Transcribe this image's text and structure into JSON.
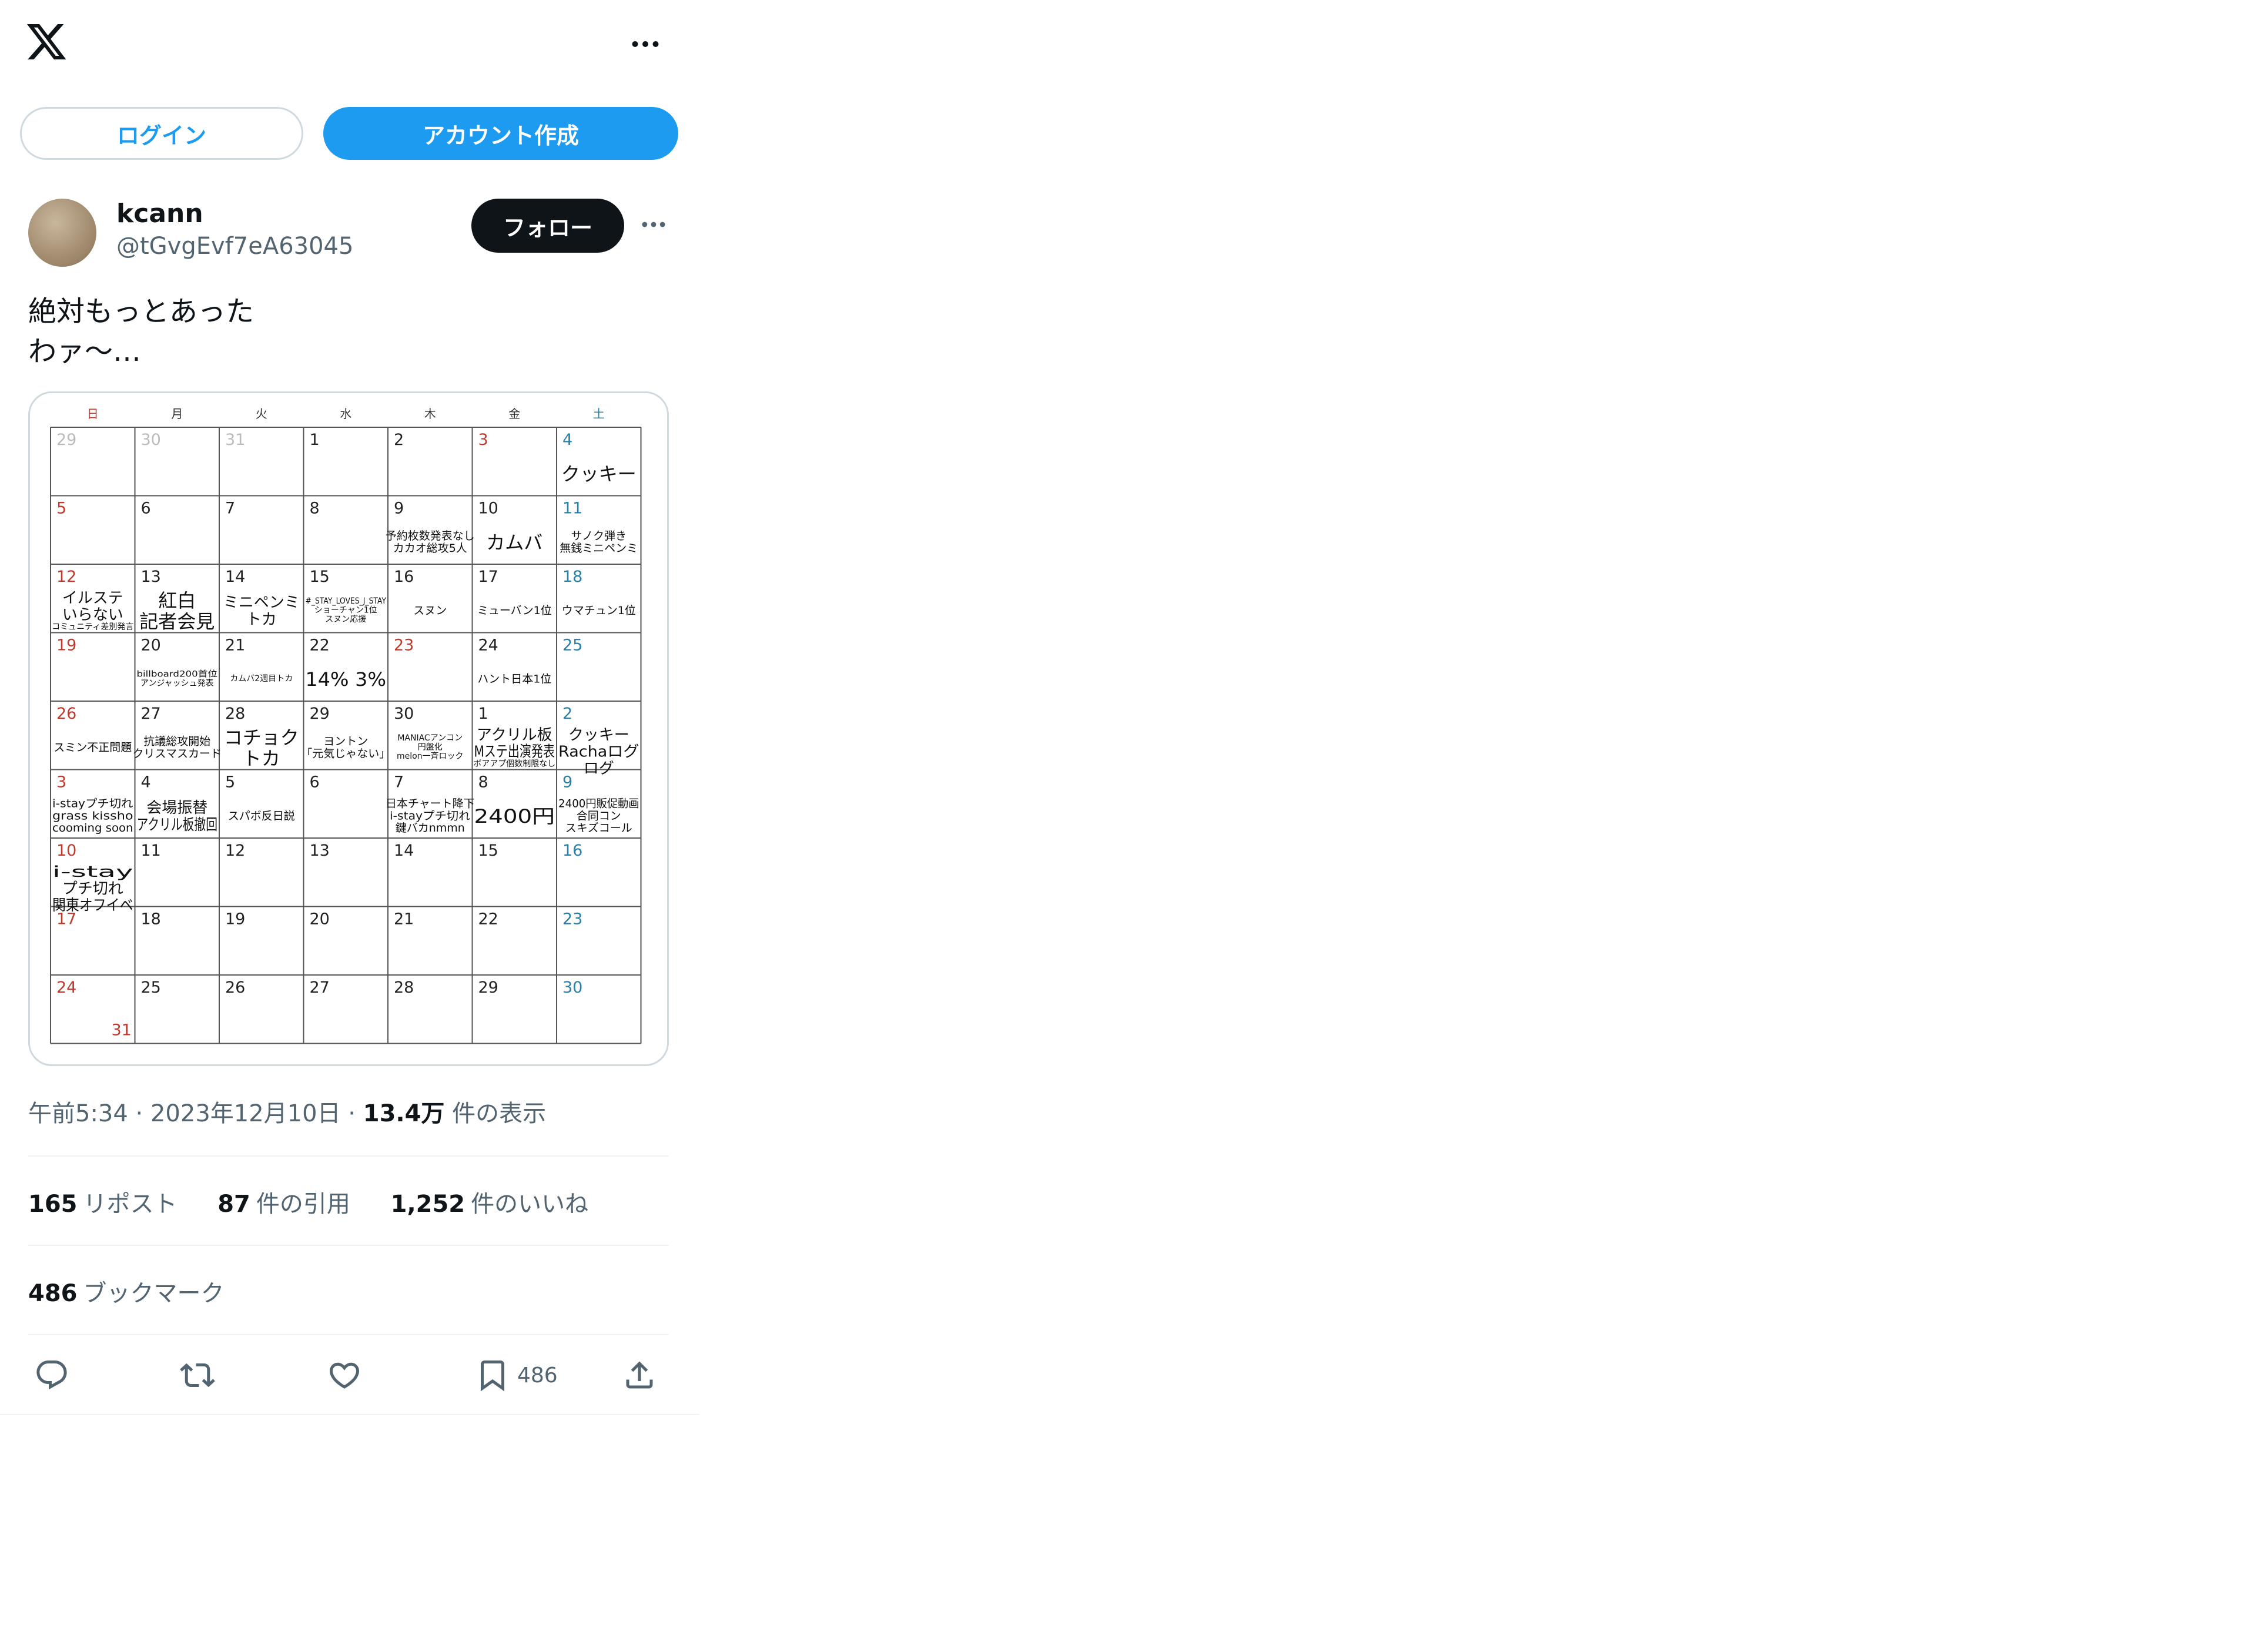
{
  "app": {
    "more_icon": "more-horizontal-icon",
    "logo_icon": "x-logo-icon"
  },
  "auth": {
    "login_label": "ログイン",
    "signup_label": "アカウント作成",
    "accent_color": "#1d9bf0"
  },
  "post": {
    "author_name": "kcann",
    "author_handle": "@tGvgEvf7eA63045",
    "follow_label": "フォロー",
    "text_lines": [
      "絶対もっとあった",
      "わァ〜…"
    ],
    "time": "午前5:34",
    "date": "2023年12月10日",
    "sep": "·",
    "views_count": "13.4万",
    "views_label": "件の表示",
    "reposts_count": "165",
    "reposts_label": "リポスト",
    "quotes_count": "87",
    "quotes_label": "件の引用",
    "likes_count": "1,252",
    "likes_label": "件のいいね",
    "bookmarks_count": "486",
    "bookmarks_label": "ブックマーク",
    "action_bookmark_count": "486"
  },
  "calendar": {
    "weekdays": [
      "日",
      "月",
      "火",
      "水",
      "木",
      "金",
      "土"
    ],
    "weekday_colors": [
      "#c0392b",
      "#333333",
      "#333333",
      "#333333",
      "#333333",
      "#333333",
      "#2a7fa8"
    ],
    "sunday_color": "#c0392b",
    "saturday_color": "#2a7fa8",
    "prev_month_color": "#bbbbbb",
    "cells": [
      {
        "d": "29",
        "faded": true,
        "notes": []
      },
      {
        "d": "30",
        "faded": true,
        "notes": []
      },
      {
        "d": "31",
        "faded": true,
        "notes": []
      },
      {
        "d": "1",
        "notes": []
      },
      {
        "d": "2",
        "notes": []
      },
      {
        "d": "3",
        "notes": [],
        "red": true
      },
      {
        "d": "4",
        "notes": [
          "クッキー"
        ],
        "size": "big"
      },
      {
        "d": "5",
        "notes": []
      },
      {
        "d": "6",
        "notes": []
      },
      {
        "d": "7",
        "notes": []
      },
      {
        "d": "8",
        "notes": []
      },
      {
        "d": "9",
        "notes": [
          "予約枚数発表なし",
          "カカオ総攻5人"
        ],
        "size": "small"
      },
      {
        "d": "10",
        "notes": [
          "カムバ"
        ],
        "size": "big"
      },
      {
        "d": "11",
        "notes": [
          "サノク弾き",
          "無銭ミニペンミ"
        ],
        "size": "small"
      },
      {
        "d": "12",
        "notes": [
          "イルステ",
          "いらない",
          "コミュニティ差別発言"
        ],
        "size": "mixed"
      },
      {
        "d": "13",
        "notes": [
          "紅白",
          "記者会見"
        ],
        "size": "big"
      },
      {
        "d": "14",
        "notes": [
          "ミニペンミ",
          "トカ"
        ],
        "size": "mid"
      },
      {
        "d": "15",
        "notes": [
          "#_STAY_LOVES_J_STAY",
          "ショーチャン1位",
          "スヌン応援"
        ],
        "size": "tiny"
      },
      {
        "d": "16",
        "notes": [
          "スヌン"
        ],
        "size": "small"
      },
      {
        "d": "17",
        "notes": [
          "ミューバン1位"
        ],
        "size": "small"
      },
      {
        "d": "18",
        "notes": [
          "ウマチュン1位"
        ],
        "size": "small"
      },
      {
        "d": "19",
        "notes": []
      },
      {
        "d": "20",
        "notes": [
          "billboard200首位",
          "アンジャッシュ発表"
        ],
        "size": "tiny"
      },
      {
        "d": "21",
        "notes": [
          "カムバ2週目トカ"
        ],
        "size": "tiny"
      },
      {
        "d": "22",
        "notes": [
          "14% 3%"
        ],
        "size": "big"
      },
      {
        "d": "23",
        "notes": [],
        "red": true
      },
      {
        "d": "24",
        "notes": [
          "ハント日本1位"
        ],
        "size": "small"
      },
      {
        "d": "25",
        "notes": []
      },
      {
        "d": "26",
        "notes": [
          "スミン不正問題"
        ],
        "size": "small"
      },
      {
        "d": "27",
        "notes": [
          "抗議総攻開始",
          "クリスマスカード"
        ],
        "size": "small"
      },
      {
        "d": "28",
        "notes": [
          "コチョク",
          "トカ"
        ],
        "size": "big"
      },
      {
        "d": "29",
        "notes": [
          "ヨントン",
          "「元気じゃない」"
        ],
        "size": "small"
      },
      {
        "d": "30",
        "notes": [
          "MANIACアンコン",
          "円盤化",
          "melon一斉ロック"
        ],
        "size": "tiny"
      },
      {
        "d": "1",
        "notes": [
          "アクリル板",
          "Mステ出演発表",
          "ボアアプ個数制限なし"
        ],
        "size": "mixed"
      },
      {
        "d": "2",
        "notes": [
          "クッキー",
          "Rachaログ",
          "ログ"
        ],
        "size": "mid"
      },
      {
        "d": "3",
        "notes": [
          "i-stayプチ切れ",
          "grass kissho",
          "cooming soon"
        ],
        "size": "small"
      },
      {
        "d": "4",
        "notes": [
          "会場振替",
          "アクリル板撤回"
        ],
        "size": "mid"
      },
      {
        "d": "5",
        "notes": [
          "スパボ反日説"
        ],
        "size": "small"
      },
      {
        "d": "6",
        "notes": []
      },
      {
        "d": "7",
        "notes": [
          "日本チャート降下",
          "i-stayプチ切れ",
          "鍵バカnmmn"
        ],
        "size": "small"
      },
      {
        "d": "8",
        "notes": [
          "2400円"
        ],
        "size": "big"
      },
      {
        "d": "9",
        "notes": [
          "2400円販促動画",
          "合同コン",
          "スキズコール"
        ],
        "size": "small"
      },
      {
        "d": "10",
        "notes": [
          "i-stay",
          "プチ切れ",
          "関東オフイベ"
        ],
        "size": "mid"
      },
      {
        "d": "11",
        "notes": []
      },
      {
        "d": "12",
        "notes": []
      },
      {
        "d": "13",
        "notes": []
      },
      {
        "d": "14",
        "notes": []
      },
      {
        "d": "15",
        "notes": []
      },
      {
        "d": "16",
        "notes": []
      },
      {
        "d": "17",
        "notes": []
      },
      {
        "d": "18",
        "notes": []
      },
      {
        "d": "19",
        "notes": []
      },
      {
        "d": "20",
        "notes": []
      },
      {
        "d": "21",
        "notes": []
      },
      {
        "d": "22",
        "notes": []
      },
      {
        "d": "23",
        "notes": []
      },
      {
        "d": "24",
        "notes": [],
        "extra": "31"
      },
      {
        "d": "25",
        "notes": []
      },
      {
        "d": "26",
        "notes": []
      },
      {
        "d": "27",
        "notes": []
      },
      {
        "d": "28",
        "notes": []
      },
      {
        "d": "29",
        "notes": []
      },
      {
        "d": "30",
        "notes": []
      }
    ]
  }
}
